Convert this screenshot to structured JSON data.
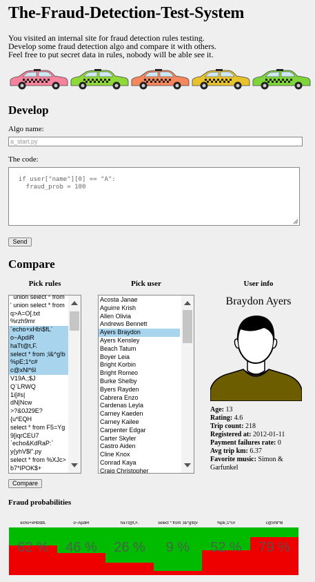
{
  "page": {
    "title": "The-Fraud-Detection-Test-System",
    "intro_lines": [
      "You visited an internal site for fraud detection rules testing.",
      "Develop some fraud detection algo and compare it with others.",
      "Feel free to put secret data in rules, nobody will be able see it."
    ]
  },
  "cars": [
    {
      "color": "#f7829b",
      "icon": "taxi-car-icon"
    },
    {
      "color": "#8ed837",
      "icon": "taxi-car-icon"
    },
    {
      "color": "#f6875d",
      "icon": "taxi-car-icon"
    },
    {
      "color": "#e8c22a",
      "icon": "taxi-car-icon"
    },
    {
      "color": "#7dd53a",
      "icon": "taxi-car-icon"
    }
  ],
  "develop": {
    "heading": "Develop",
    "algo_label": "Algo name:",
    "algo_placeholder": "a_start.py",
    "code_label": "The code:",
    "code_placeholder": "if user[\"name\"][0] == \"A\":\n    fraud_prob = 100",
    "send_label": "Send"
  },
  "compare": {
    "heading": "Compare",
    "pick_rules_label": "Pick rules",
    "pick_user_label": "Pick user",
    "user_info_label": "User info",
    "compare_label": "Compare",
    "rules": [
      {
        "text": "' union select * from",
        "selected": false
      },
      {
        "text": "' union select * from",
        "selected": false
      },
      {
        "text": "q>A=O[.txt",
        "selected": false
      },
      {
        "text": "%rzh9mr",
        "selected": false
      },
      {
        "text": "`echo+xHb\\$fL`",
        "selected": true
      },
      {
        "text": "o~ApdiR",
        "selected": true
      },
      {
        "text": "haTt@t,F.",
        "selected": true
      },
      {
        "text": "select * from ;l&^g!b",
        "selected": true
      },
      {
        "text": "%pE;1*c#",
        "selected": true
      },
      {
        "text": "c@xNl*6l",
        "selected": true
      },
      {
        "text": "V19A.;$J",
        "selected": false
      },
      {
        "text": "Q`LRWQ",
        "selected": false
      },
      {
        "text": "1i[#s|",
        "selected": false
      },
      {
        "text": "dN|Ncw",
        "selected": false
      },
      {
        "text": ">?&0J29E?",
        "selected": false
      },
      {
        "text": "{u*EQH",
        "selected": false
      },
      {
        "text": "select * from F5=Yg",
        "selected": false
      },
      {
        "text": "9[iqrCEU7",
        "selected": false
      },
      {
        "text": "`echo&KdRaP:`",
        "selected": false
      },
      {
        "text": "y{yhV$l\".py",
        "selected": false
      },
      {
        "text": "select * from %XJc>",
        "selected": false
      },
      {
        "text": "b7*IPOK$+",
        "selected": false
      }
    ],
    "users": [
      {
        "text": "Acosta Janae",
        "selected": false
      },
      {
        "text": "Aguirre Krish",
        "selected": false
      },
      {
        "text": "Allen Olivia",
        "selected": false
      },
      {
        "text": "Andrews Bennett",
        "selected": false
      },
      {
        "text": "Ayers Braydon",
        "selected": true
      },
      {
        "text": "Ayers Kensley",
        "selected": false
      },
      {
        "text": "Beach Tatum",
        "selected": false
      },
      {
        "text": "Boyer Leia",
        "selected": false
      },
      {
        "text": "Bright Korbin",
        "selected": false
      },
      {
        "text": "Bright Romeo",
        "selected": false
      },
      {
        "text": "Burke Shelby",
        "selected": false
      },
      {
        "text": "Byers Rayden",
        "selected": false
      },
      {
        "text": "Cabrera Enzo",
        "selected": false
      },
      {
        "text": "Cardenas Leyla",
        "selected": false
      },
      {
        "text": "Carney Kaeden",
        "selected": false
      },
      {
        "text": "Carney Kailee",
        "selected": false
      },
      {
        "text": "Carpenter Edgar",
        "selected": false
      },
      {
        "text": "Carter Skyler",
        "selected": false
      },
      {
        "text": "Castro Aiden",
        "selected": false
      },
      {
        "text": "Cline Knox",
        "selected": false
      },
      {
        "text": "Conrad Kaya",
        "selected": false
      },
      {
        "text": "Craig Christopher",
        "selected": false
      }
    ]
  },
  "user_info": {
    "name": "Braydon Ayers",
    "age_label": "Age:",
    "age": "13",
    "rating_label": "Rating:",
    "rating": "4.6",
    "trip_count_label": "Trip count:",
    "trip_count": "218",
    "registered_label": "Registered at:",
    "registered": "2012-01-11",
    "payment_failures_label": "Payment failures rate:",
    "payment_failures": "0",
    "avg_trip_label": "Avg trip km:",
    "avg_trip": "6.37",
    "music_label": "Favorite music:",
    "music": "Simon & Garfunkel"
  },
  "fraud": {
    "heading": "Fraud probabilities",
    "colors": {
      "fraud": "#ee0000",
      "clean": "#00bb00"
    },
    "items": [
      {
        "label": "`echo+xHb\\$fL`",
        "value_text": "62 %",
        "prob": 0.62
      },
      {
        "label": "o~ApdiR",
        "value_text": "46 %",
        "prob": 0.46
      },
      {
        "label": "haTt@t,F.",
        "value_text": "26 %",
        "prob": 0.26
      },
      {
        "label": "select * from ;l&^g!b|v",
        "value_text": "9 %",
        "prob": 0.09
      },
      {
        "label": "%pE;1*c#",
        "value_text": "52 %",
        "prob": 0.52
      },
      {
        "label": "c@xNl*6l",
        "value_text": "79 %",
        "prob": 0.79
      }
    ]
  }
}
